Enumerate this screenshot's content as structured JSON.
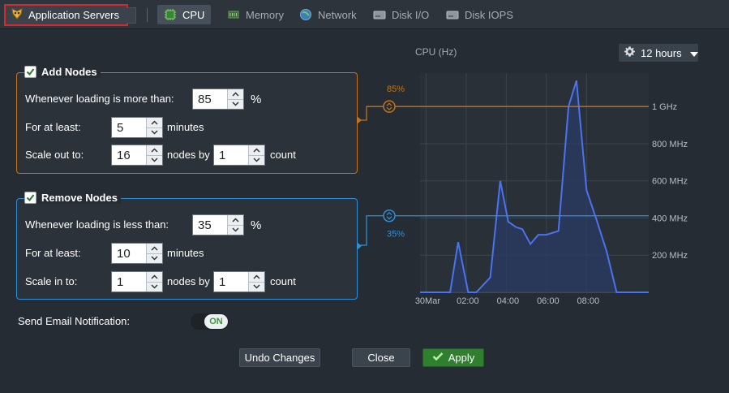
{
  "toolbar": {
    "server_label": "Application Servers",
    "tabs": [
      {
        "label": "CPU",
        "icon": "cpu-icon",
        "active": true
      },
      {
        "label": "Memory",
        "icon": "memory-icon",
        "active": false
      },
      {
        "label": "Network",
        "icon": "globe-icon",
        "active": false
      },
      {
        "label": "Disk I/O",
        "icon": "disk-icon",
        "active": false
      },
      {
        "label": "Disk IOPS",
        "icon": "disk-icon",
        "active": false
      }
    ]
  },
  "add_nodes": {
    "title": "Add Nodes",
    "checked": true,
    "loading_label": "Whenever loading is more than:",
    "loading_value": "85",
    "loading_unit": "%",
    "duration_label": "For at least:",
    "duration_value": "5",
    "duration_unit": "minutes",
    "scale_label": "Scale out to:",
    "scale_value": "16",
    "step_label": "nodes by",
    "step_value": "1",
    "step_unit": "count",
    "color": "#c2731c"
  },
  "remove_nodes": {
    "title": "Remove Nodes",
    "checked": true,
    "loading_label": "Whenever loading is less than:",
    "loading_value": "35",
    "loading_unit": "%",
    "duration_label": "For at least:",
    "duration_value": "10",
    "duration_unit": "minutes",
    "scale_label": "Scale in to:",
    "scale_value": "1",
    "step_label": "nodes by",
    "step_value": "1",
    "step_unit": "count",
    "color": "#2e8fd6"
  },
  "email": {
    "label": "Send Email Notification:",
    "toggle_label": "ON",
    "enabled": true
  },
  "actions": {
    "undo_label": "Undo Changes",
    "close_label": "Close",
    "apply_label": "Apply"
  },
  "range": {
    "label": "12 hours"
  },
  "chart_data": {
    "type": "area",
    "title": "CPU (Hz)",
    "x_tick_labels": [
      "30Mar",
      "02:00",
      "04:00",
      "06:00",
      "08:00"
    ],
    "x_ticks_hours": [
      0,
      2,
      4,
      6,
      8
    ],
    "y_tick_labels": [
      "1 GHz",
      "800 MHz",
      "600 MHz",
      "400 MHz",
      "200 MHz"
    ],
    "y_ticks_mhz": [
      1000,
      800,
      600,
      400,
      200
    ],
    "ylim": [
      0,
      1180
    ],
    "xlim": [
      -0.3,
      11.1
    ],
    "thresholds": [
      {
        "label": "85%",
        "value_mhz": 1000,
        "color": "#c2731c"
      },
      {
        "label": "35%",
        "value_mhz": 412,
        "color": "#2e8fd6"
      }
    ],
    "series": [
      {
        "color": "#4a73f0",
        "x": [
          -0.3,
          0.7,
          1.2,
          1.6,
          2.1,
          2.5,
          3.2,
          3.7,
          4.1,
          4.5,
          4.8,
          5.2,
          5.6,
          6.0,
          6.6,
          7.1,
          7.5,
          8.0,
          8.5,
          9.0,
          9.5,
          10.1,
          11.1
        ],
        "y": [
          0,
          0,
          0,
          270,
          0,
          0,
          80,
          600,
          380,
          350,
          340,
          260,
          310,
          310,
          330,
          1000,
          1140,
          550,
          390,
          220,
          0,
          0,
          0
        ]
      }
    ]
  }
}
